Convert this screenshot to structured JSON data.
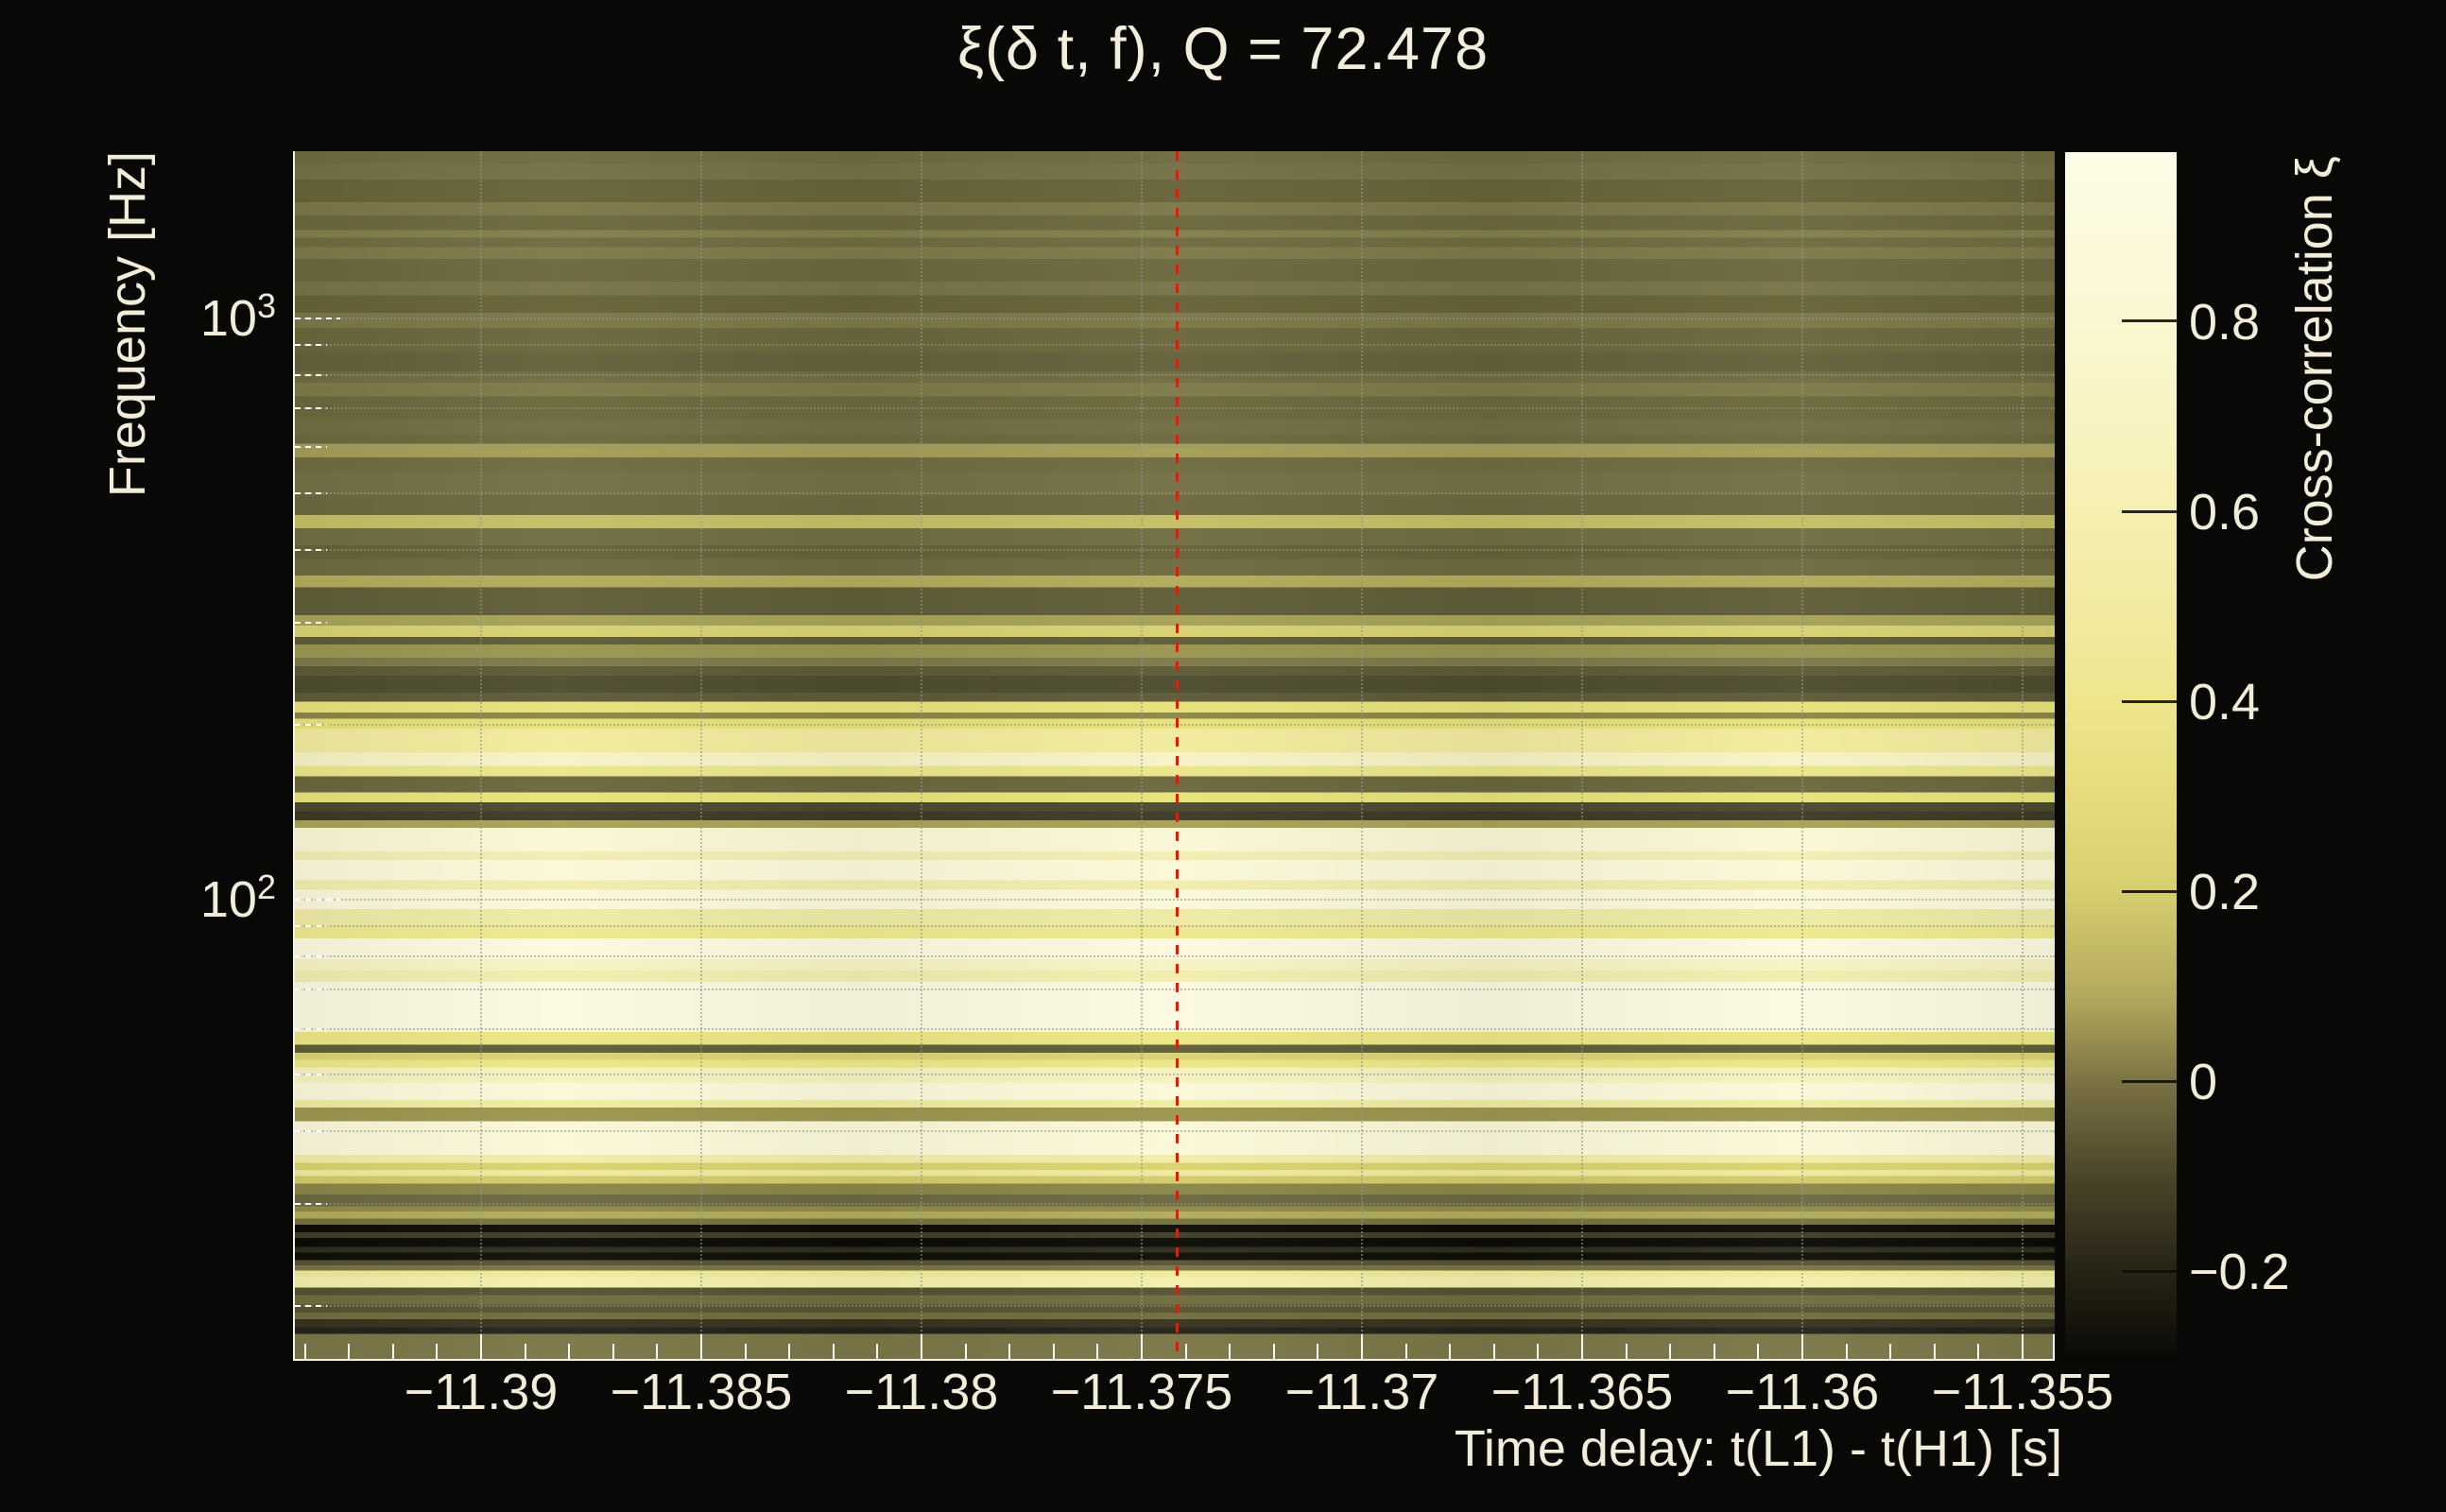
{
  "chart_data": {
    "type": "heatmap",
    "title": "ξ(δ t, f), Q = 72.478",
    "x": {
      "label": "Time delay: t(L1) - t(H1) [s]",
      "min": -11.39427,
      "max": -11.35427,
      "major_tick_values": [
        -11.39,
        -11.385,
        -11.38,
        -11.375,
        -11.37,
        -11.365,
        -11.36,
        -11.355
      ],
      "major_tick_labels": [
        "−11.39",
        "−11.385",
        "−11.38",
        "−11.375",
        "−11.37",
        "−11.365",
        "−11.36",
        "−11.355"
      ],
      "minor_tick_step": 0.001,
      "grid": "dotted at major ticks"
    },
    "y": {
      "label": "Frequency [Hz]",
      "scale": "log",
      "min": 16.1,
      "max": 1940,
      "major_ticks": [
        {
          "value": 1000,
          "mantissa": "10",
          "exponent": "3"
        },
        {
          "value": 100,
          "mantissa": "10",
          "exponent": "2"
        }
      ],
      "gridline_values": [
        1000,
        900,
        800,
        700,
        600,
        500,
        400,
        300,
        200,
        100,
        90,
        80,
        70,
        60,
        50,
        40,
        30,
        20
      ],
      "grid": "dotted at decade and sub-decade lines"
    },
    "z": {
      "label": "Cross-correlation ξ",
      "min": -0.292,
      "max": 0.978,
      "tick_values": [
        0.8,
        0.6,
        0.4,
        0.2,
        0,
        -0.2
      ],
      "tick_labels": [
        "0.8",
        "0.6",
        "0.4",
        "0.2",
        "0",
        "−0.2"
      ],
      "colormap_stops": [
        [
          0.0,
          "#fdfce8"
        ],
        [
          0.05,
          "#fcfade"
        ],
        [
          0.14,
          "#faf7d2"
        ],
        [
          0.22,
          "#f8f3c2"
        ],
        [
          0.3,
          "#f5efb1"
        ],
        [
          0.38,
          "#f2eaa0"
        ],
        [
          0.455,
          "#eee58d"
        ],
        [
          0.53,
          "#e6dc7e"
        ],
        [
          0.61,
          "#d8cf70"
        ],
        [
          0.7,
          "#b3a95c"
        ],
        [
          0.77,
          "#7b7344"
        ],
        [
          0.85,
          "#4a4429"
        ],
        [
          0.93,
          "#262214"
        ],
        [
          1.0,
          "#0a0906"
        ]
      ]
    },
    "marker": {
      "x_value": -11.3742,
      "style": "vertical dashed line",
      "color": "#ee1606"
    },
    "legend_position": "right colorbar",
    "stripes_note": "horizontal frequency bands [f_high_Hz, f_low_Hz, color, approx_xi]; correlation is nearly constant in time-delay",
    "stripes": [
      [
        1940,
        1848,
        "#6e6a41",
        0.03
      ],
      [
        1848,
        1734,
        "#747045",
        0.05
      ],
      [
        1734,
        1586,
        "#676339",
        0.0
      ],
      [
        1586,
        1505,
        "#7b7749",
        0.07
      ],
      [
        1505,
        1418,
        "#6b673d",
        0.02
      ],
      [
        1418,
        1377,
        "#827e4d",
        0.09
      ],
      [
        1377,
        1326,
        "#6e6a40",
        0.03
      ],
      [
        1326,
        1267,
        "#7d794a",
        0.07
      ],
      [
        1267,
        1157,
        "#6b673e",
        0.02
      ],
      [
        1157,
        1097,
        "#777347",
        0.05
      ],
      [
        1097,
        1022,
        "#666238",
        0.0
      ],
      [
        1022,
        963,
        "#7b7748",
        0.07
      ],
      [
        963,
        874,
        "#6a663c",
        0.01
      ],
      [
        874,
        811,
        "#63603a",
        -0.01
      ],
      [
        811,
        775,
        "#6f6b41",
        0.03
      ],
      [
        775,
        735,
        "#7d7949",
        0.07
      ],
      [
        735,
        671,
        "#6b673d",
        0.02
      ],
      [
        671,
        632,
        "#716d43",
        0.04
      ],
      [
        632,
        609,
        "#6b673e",
        0.02
      ],
      [
        609,
        577,
        "#a39d56",
        0.17
      ],
      [
        577,
        543,
        "#6f6b41",
        0.03
      ],
      [
        543,
        498,
        "#747045",
        0.05
      ],
      [
        498,
        459,
        "#6c683f",
        0.02
      ],
      [
        459,
        436,
        "#c4be67",
        0.3
      ],
      [
        436,
        407,
        "#716d42",
        0.04
      ],
      [
        407,
        386,
        "#656138",
        0.0
      ],
      [
        386,
        361,
        "#6e6a40",
        0.03
      ],
      [
        361,
        345,
        "#b1ab5c",
        0.24
      ],
      [
        345,
        309,
        "#605d38",
        -0.02
      ],
      [
        309,
        296,
        "#a8a257",
        0.19
      ],
      [
        296,
        283,
        "#d7d173",
        0.37
      ],
      [
        283,
        275,
        "#5e5b37",
        -0.03
      ],
      [
        275,
        261,
        "#9a954f",
        0.16
      ],
      [
        261,
        252,
        "#7d794a",
        0.07
      ],
      [
        252,
        243,
        "#5d5a36",
        -0.04
      ],
      [
        243,
        227,
        "#4e4c2f",
        -0.09
      ],
      [
        227,
        219,
        "#5d5a36",
        -0.04
      ],
      [
        219,
        210,
        "#e7e17b",
        0.44
      ],
      [
        210,
        205,
        "#8a8549",
        0.12
      ],
      [
        205,
        197,
        "#e7e17b",
        0.44
      ],
      [
        197,
        179,
        "#f0eb9d",
        0.57
      ],
      [
        179,
        170,
        "#f7f3c6",
        0.72
      ],
      [
        170,
        163,
        "#ebe68c",
        0.48
      ],
      [
        163,
        153,
        "#6a673e",
        0.02
      ],
      [
        153,
        147,
        "#e8e37c",
        0.45
      ],
      [
        147,
        142,
        "#4a4830",
        -0.1
      ],
      [
        142,
        137,
        "#3c3a26",
        -0.14
      ],
      [
        137,
        133,
        "#a8a257",
        0.19
      ],
      [
        133,
        121,
        "#faf7d6",
        0.85
      ],
      [
        121,
        117,
        "#f3eeb2",
        0.68
      ],
      [
        117,
        108,
        "#fbf8da",
        0.87
      ],
      [
        108,
        104,
        "#f2edae",
        0.66
      ],
      [
        104,
        96.3,
        "#fbf8dc",
        0.88
      ],
      [
        96.3,
        90.5,
        "#efeaa4",
        0.6
      ],
      [
        90.5,
        85.8,
        "#eee98f",
        0.53
      ],
      [
        85.8,
        79,
        "#fcf9e0",
        0.9
      ],
      [
        79,
        75.5,
        "#f7f3c2",
        0.73
      ],
      [
        75.5,
        72.2,
        "#f2edb0",
        0.66
      ],
      [
        72.2,
        59.2,
        "#fcf9e2",
        0.91
      ],
      [
        59.2,
        56.3,
        "#ebe685",
        0.49
      ],
      [
        56.3,
        54.6,
        "#5f5c38",
        -0.03
      ],
      [
        54.6,
        53,
        "#d9d371",
        0.36
      ],
      [
        53,
        51.5,
        "#ece887",
        0.5
      ],
      [
        51.5,
        48.5,
        "#f6f2c0",
        0.72
      ],
      [
        48.5,
        45.2,
        "#fbf8da",
        0.87
      ],
      [
        45.2,
        43.9,
        "#f0eca2",
        0.6
      ],
      [
        43.9,
        41.6,
        "#9a954f",
        0.16
      ],
      [
        41.6,
        36.4,
        "#fbf8da",
        0.87
      ],
      [
        36.4,
        35.3,
        "#f2eda8",
        0.63
      ],
      [
        35.3,
        34.3,
        "#d9d36f",
        0.35
      ],
      [
        34.3,
        33.5,
        "#eee9a0",
        0.58
      ],
      [
        33.5,
        32.5,
        "#d2cb6a",
        0.32
      ],
      [
        32.5,
        31.1,
        "#8a8549",
        0.12
      ],
      [
        31.1,
        29.7,
        "#6c6941",
        0.02
      ],
      [
        29.7,
        29.1,
        "#8f8a4c",
        0.13
      ],
      [
        29.1,
        28.3,
        "#b1ab5a",
        0.24
      ],
      [
        28.3,
        27.6,
        "#74713f",
        0.05
      ],
      [
        27.6,
        26.8,
        "#0d0c08",
        -0.28
      ],
      [
        26.8,
        26.2,
        "#3f3d27",
        -0.13
      ],
      [
        26.2,
        25.3,
        "#0a0a06",
        -0.29
      ],
      [
        25.3,
        24.7,
        "#2e2d1d",
        -0.18
      ],
      [
        24.7,
        24.0,
        "#0e0d08",
        -0.28
      ],
      [
        24.0,
        23.5,
        "#565433",
        -0.06
      ],
      [
        23.5,
        23.0,
        "#767347",
        0.05
      ],
      [
        23.0,
        22.5,
        "#efeb9a",
        0.56
      ],
      [
        22.5,
        21.5,
        "#f3efac",
        0.63
      ],
      [
        21.5,
        20.9,
        "#545230",
        -0.07
      ],
      [
        20.9,
        20.1,
        "#6f6c3f",
        0.03
      ],
      [
        20.1,
        19.5,
        "#55532f",
        -0.06
      ],
      [
        19.5,
        19.0,
        "#6f6c3f",
        0.03
      ],
      [
        19.0,
        18.4,
        "#36341f",
        -0.17
      ],
      [
        18.4,
        17.9,
        "#23221a",
        -0.22
      ],
      [
        17.9,
        16.1,
        "#7a7648",
        0.06
      ]
    ]
  },
  "style": {
    "background": "#080806",
    "text_color": "#f2edd9",
    "frame_color": "#f5f2e2",
    "marker_color": "#ee1606"
  }
}
